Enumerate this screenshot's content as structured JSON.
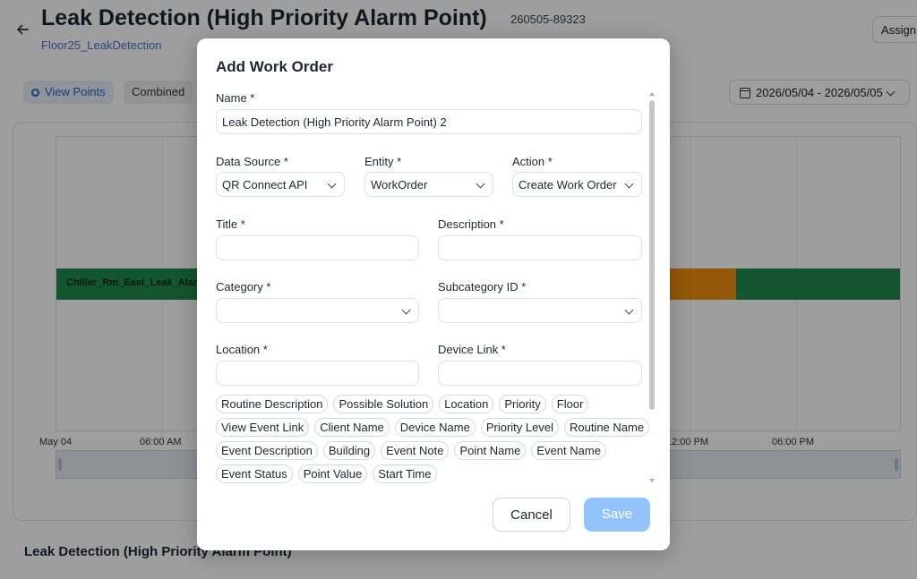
{
  "background": {
    "title": "Leak Detection (High Priority Alarm Point)",
    "id": "260505-89323",
    "subtitle": "Floor25_LeakDetection",
    "assign_label": "Assign",
    "tabs": [
      "View Points",
      "Combined"
    ],
    "date_range": "2026/05/04 - 2026/05/05",
    "timeline_label": "Chiller_Rm_East_Leak_Alarm",
    "axis_ticks": [
      "May 04",
      "06:00 AM",
      "12:00 PM",
      "06:00 PM"
    ],
    "section_title": "Leak Detection (High Priority Alarm Point)",
    "colors": {
      "ok": "#1f8a4c",
      "warning": "#ef8e0d"
    }
  },
  "modal": {
    "title": "Add Work Order",
    "name": {
      "label": "Name *",
      "value": "Leak Detection (High Priority Alarm Point) 2"
    },
    "data_source": {
      "label": "Data Source *",
      "value": "QR Connect API"
    },
    "entity": {
      "label": "Entity *",
      "value": "WorkOrder"
    },
    "action": {
      "label": "Action *",
      "value": "Create Work Order"
    },
    "title_field": {
      "label": "Title *",
      "value": ""
    },
    "description": {
      "label": "Description *",
      "value": ""
    },
    "category": {
      "label": "Category *",
      "value": ""
    },
    "subcategory": {
      "label": "Subcategory ID *",
      "value": ""
    },
    "location": {
      "label": "Location *",
      "value": ""
    },
    "device_link": {
      "label": "Device Link *",
      "value": ""
    },
    "chips": [
      [
        "Routine Description",
        "Possible Solution",
        "Location",
        "Priority",
        "Floor"
      ],
      [
        "View Event Link",
        "Client Name",
        "Device Name",
        "Priority Level",
        "Routine Name"
      ],
      [
        "Event Description",
        "Building",
        "Event Note",
        "Point Name",
        "Event Name"
      ],
      [
        "Event Status",
        "Point Value",
        "Start Time"
      ]
    ],
    "cancel_label": "Cancel",
    "save_label": "Save",
    "colors": {
      "save": "#93c3fb"
    }
  }
}
